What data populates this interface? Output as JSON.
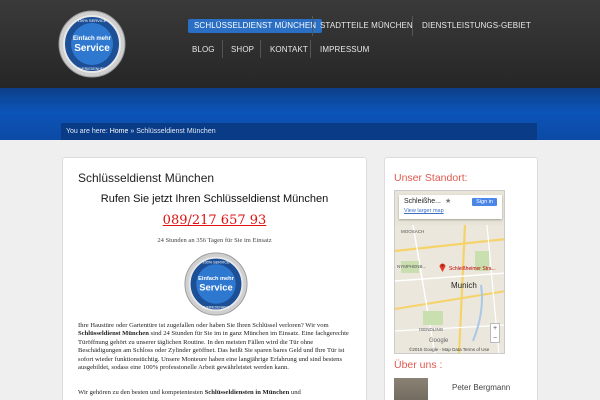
{
  "nav": {
    "items": [
      {
        "label": "SCHLÜSSELDIENST MÜNCHEN",
        "active": true
      },
      {
        "label": "STADTTEILE MÜNCHEN"
      },
      {
        "label": "DIENSTLEISTUNGS-GEBIET"
      },
      {
        "label": "BLOG"
      },
      {
        "label": "SHOP"
      },
      {
        "label": "KONTAKT"
      },
      {
        "label": "IMPRESSUM"
      }
    ]
  },
  "logo": {
    "text_top": "100% SERVICE",
    "text_main_1": "Einfach mehr",
    "text_main_2": "Service",
    "text_bottom": "ZUFRIEDENHEIT"
  },
  "breadcrumb": {
    "prefix": "You are here:",
    "home": "Home",
    "separator": "»",
    "current": "Schlüsseldienst München"
  },
  "content": {
    "title": "Schlüsseldienst München",
    "cta_heading": "Rufen Sie jetzt Ihren Schlüsseldienst München",
    "phone": "089/217 657 93",
    "hours": "24 Stunden an 356 Tagen für Sie im Einsatz",
    "para1_a": "Ihre Haustüre oder Gartentüre ist zugefallen oder haben Sie Ihren Schlüssel verloren? Wir vom ",
    "para1_bold": "Schlüsseldienst München",
    "para1_b": " sind 24 Stunden für Sie im in ganz München im Einsatz. Eine fachgerechte Türöffnung gehört zu unserer täglichen Routine. In den meisten Fällen wird die Tür ohne Beschädigungen am Schloss oder Zylinder geöffnet. Das heißt Sie sparen bares Geld und Ihre Tür ist sofort wieder funktionstüchtig. Unsere Monteure haben eine langjährige Erfahrung und sind bestens ausgebildet, sodass eine 100% professionelle Arbeit gewährleistet werden kann.",
    "para2_a": "Wir gehören zu den besten und kompetentesten ",
    "para2_bold": "Schlüsseldiensten in München",
    "para2_b": " und"
  },
  "sidebar": {
    "location_heading": "Unser Standort:",
    "map": {
      "place": "Schleißhe...",
      "larger_map": "View larger map",
      "sign_in": "Sign in",
      "city": "Munich",
      "pin_label": "Schleißheimer Stra...",
      "labels": [
        "MOOSACH",
        "NYMPHENB...",
        "ISENDLING"
      ],
      "google": "Google",
      "credit": "©2015 Google - Map Data   Terms of Use"
    },
    "about_heading": "Über uns :",
    "person": "Peter Bergmann"
  },
  "colors": {
    "accent": "#2a6fc4",
    "heading": "#e05a4f",
    "phone": "#dd1111",
    "banner": "#0c54b8"
  }
}
